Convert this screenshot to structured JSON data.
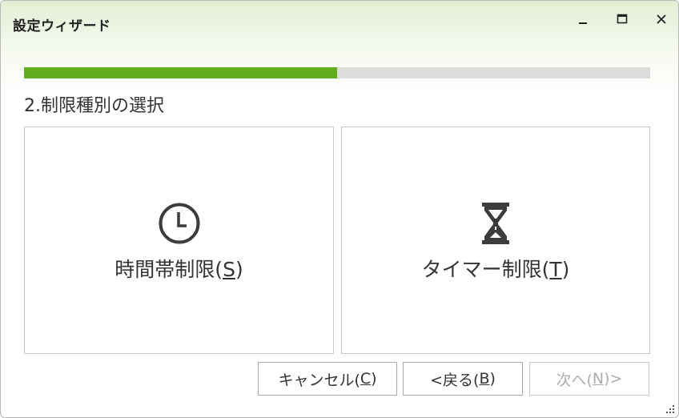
{
  "window": {
    "title": "設定ウィザード",
    "controls": {
      "minimize_icon": "minimize-icon",
      "maximize_icon": "maximize-icon",
      "close_icon": "close-icon"
    }
  },
  "progress": {
    "fraction": 0.5
  },
  "step": {
    "title": "2.制限種別の選択"
  },
  "options": [
    {
      "icon": "clock-icon",
      "label_before": "時間帯制限(",
      "mnemonic": "S",
      "label_after": ")"
    },
    {
      "icon": "hourglass-icon",
      "label_before": "タイマー制限(",
      "mnemonic": "T",
      "label_after": ")"
    }
  ],
  "buttons": {
    "cancel": {
      "label_before": "キャンセル(",
      "mnemonic": "C",
      "label_after": ")"
    },
    "back": {
      "label_before": "<戻る(",
      "mnemonic": "B",
      "label_after": ")"
    },
    "next": {
      "label_before": "次へ(",
      "mnemonic": "N",
      "label_after": ")>",
      "enabled": false
    }
  },
  "colors": {
    "accent": "#62ad1e",
    "track": "#dcdcdc",
    "text": "#333333",
    "disabled_text": "#adadad"
  }
}
